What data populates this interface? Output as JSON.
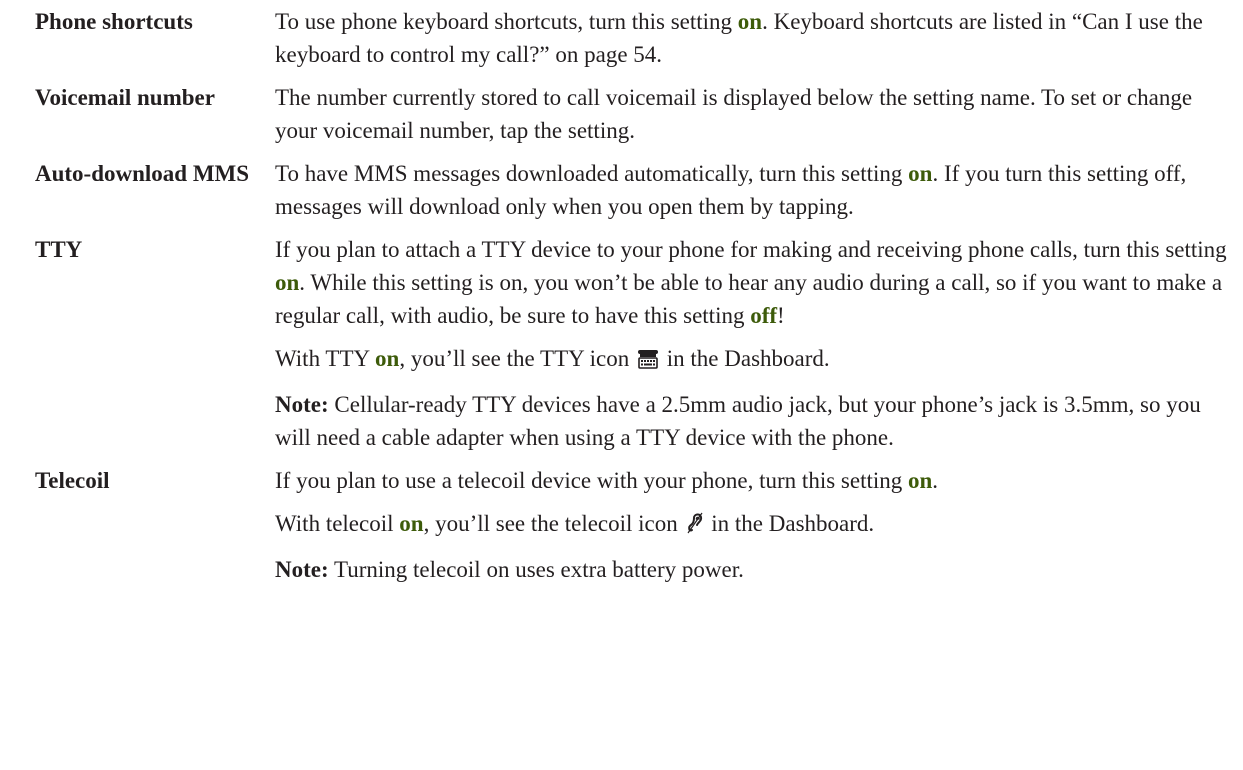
{
  "colors": {
    "text": "#231f20",
    "keyword": "#3d5b0a"
  },
  "settings": [
    {
      "term": "Phone shortcuts",
      "p1_a": "To use phone keyboard shortcuts, turn this setting ",
      "p1_kw": "on",
      "p1_b": ". Keyboard shortcuts are listed in “Can I use the keyboard to control my call?” on page 54."
    },
    {
      "term": "Voicemail number",
      "p1": "The number currently stored to call voicemail is displayed below the setting name. To set or change your voicemail number, tap the setting."
    },
    {
      "term": "Auto-download MMS",
      "p1_a": "To have MMS messages downloaded automatically, turn this setting ",
      "p1_kw": "on",
      "p1_b": ". If you turn this setting off, messages will download only when you open them by tapping."
    },
    {
      "term": "TTY",
      "p1_a": "If you plan to attach a TTY device to your phone for making and receiving phone calls, turn this setting ",
      "p1_kw": "on",
      "p1_b": ". While this setting is on, you won’t be able to hear any audio during a call, so if you want to make a regular call, with audio, be sure to have this setting ",
      "p1_kw2": "off",
      "p1_c": "!",
      "p2_a": "With TTY ",
      "p2_kw": "on",
      "p2_b": ", you’ll see the TTY icon ",
      "p2_c": " in the Dashboard.",
      "p2_icon": "tty-icon",
      "note_label": "Note:",
      "note_text": " Cellular-ready TTY devices have a 2.5mm audio jack, but your phone’s jack is 3.5mm, so you will need a cable adapter when using a TTY device with the phone."
    },
    {
      "term": "Telecoil",
      "p1_a": "If you plan to use a telecoil device with your phone, turn this setting ",
      "p1_kw": "on",
      "p1_b": ".",
      "p2_a": "With telecoil ",
      "p2_kw": "on",
      "p2_b": ", you’ll see the telecoil icon ",
      "p2_c": " in the Dashboard.",
      "p2_icon": "telecoil-icon",
      "note_label": "Note:",
      "note_text": " Turning telecoil on uses extra battery power."
    }
  ]
}
